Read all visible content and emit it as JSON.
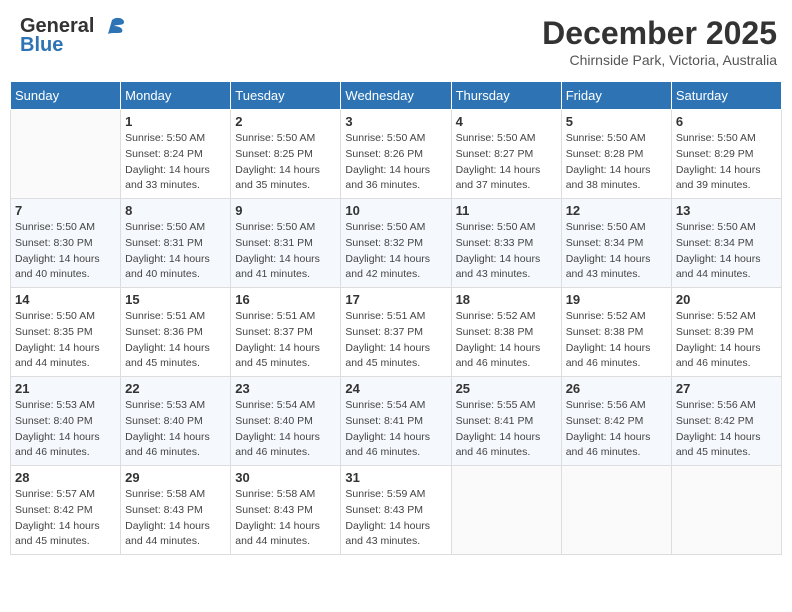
{
  "header": {
    "logo_general": "General",
    "logo_blue": "Blue",
    "month_title": "December 2025",
    "location": "Chirnside Park, Victoria, Australia"
  },
  "days_of_week": [
    "Sunday",
    "Monday",
    "Tuesday",
    "Wednesday",
    "Thursday",
    "Friday",
    "Saturday"
  ],
  "weeks": [
    [
      {
        "day": "",
        "sunrise": "",
        "sunset": "",
        "daylight": ""
      },
      {
        "day": "1",
        "sunrise": "Sunrise: 5:50 AM",
        "sunset": "Sunset: 8:24 PM",
        "daylight": "Daylight: 14 hours and 33 minutes."
      },
      {
        "day": "2",
        "sunrise": "Sunrise: 5:50 AM",
        "sunset": "Sunset: 8:25 PM",
        "daylight": "Daylight: 14 hours and 35 minutes."
      },
      {
        "day": "3",
        "sunrise": "Sunrise: 5:50 AM",
        "sunset": "Sunset: 8:26 PM",
        "daylight": "Daylight: 14 hours and 36 minutes."
      },
      {
        "day": "4",
        "sunrise": "Sunrise: 5:50 AM",
        "sunset": "Sunset: 8:27 PM",
        "daylight": "Daylight: 14 hours and 37 minutes."
      },
      {
        "day": "5",
        "sunrise": "Sunrise: 5:50 AM",
        "sunset": "Sunset: 8:28 PM",
        "daylight": "Daylight: 14 hours and 38 minutes."
      },
      {
        "day": "6",
        "sunrise": "Sunrise: 5:50 AM",
        "sunset": "Sunset: 8:29 PM",
        "daylight": "Daylight: 14 hours and 39 minutes."
      }
    ],
    [
      {
        "day": "7",
        "sunrise": "Sunrise: 5:50 AM",
        "sunset": "Sunset: 8:30 PM",
        "daylight": "Daylight: 14 hours and 40 minutes."
      },
      {
        "day": "8",
        "sunrise": "Sunrise: 5:50 AM",
        "sunset": "Sunset: 8:31 PM",
        "daylight": "Daylight: 14 hours and 40 minutes."
      },
      {
        "day": "9",
        "sunrise": "Sunrise: 5:50 AM",
        "sunset": "Sunset: 8:31 PM",
        "daylight": "Daylight: 14 hours and 41 minutes."
      },
      {
        "day": "10",
        "sunrise": "Sunrise: 5:50 AM",
        "sunset": "Sunset: 8:32 PM",
        "daylight": "Daylight: 14 hours and 42 minutes."
      },
      {
        "day": "11",
        "sunrise": "Sunrise: 5:50 AM",
        "sunset": "Sunset: 8:33 PM",
        "daylight": "Daylight: 14 hours and 43 minutes."
      },
      {
        "day": "12",
        "sunrise": "Sunrise: 5:50 AM",
        "sunset": "Sunset: 8:34 PM",
        "daylight": "Daylight: 14 hours and 43 minutes."
      },
      {
        "day": "13",
        "sunrise": "Sunrise: 5:50 AM",
        "sunset": "Sunset: 8:34 PM",
        "daylight": "Daylight: 14 hours and 44 minutes."
      }
    ],
    [
      {
        "day": "14",
        "sunrise": "Sunrise: 5:50 AM",
        "sunset": "Sunset: 8:35 PM",
        "daylight": "Daylight: 14 hours and 44 minutes."
      },
      {
        "day": "15",
        "sunrise": "Sunrise: 5:51 AM",
        "sunset": "Sunset: 8:36 PM",
        "daylight": "Daylight: 14 hours and 45 minutes."
      },
      {
        "day": "16",
        "sunrise": "Sunrise: 5:51 AM",
        "sunset": "Sunset: 8:37 PM",
        "daylight": "Daylight: 14 hours and 45 minutes."
      },
      {
        "day": "17",
        "sunrise": "Sunrise: 5:51 AM",
        "sunset": "Sunset: 8:37 PM",
        "daylight": "Daylight: 14 hours and 45 minutes."
      },
      {
        "day": "18",
        "sunrise": "Sunrise: 5:52 AM",
        "sunset": "Sunset: 8:38 PM",
        "daylight": "Daylight: 14 hours and 46 minutes."
      },
      {
        "day": "19",
        "sunrise": "Sunrise: 5:52 AM",
        "sunset": "Sunset: 8:38 PM",
        "daylight": "Daylight: 14 hours and 46 minutes."
      },
      {
        "day": "20",
        "sunrise": "Sunrise: 5:52 AM",
        "sunset": "Sunset: 8:39 PM",
        "daylight": "Daylight: 14 hours and 46 minutes."
      }
    ],
    [
      {
        "day": "21",
        "sunrise": "Sunrise: 5:53 AM",
        "sunset": "Sunset: 8:40 PM",
        "daylight": "Daylight: 14 hours and 46 minutes."
      },
      {
        "day": "22",
        "sunrise": "Sunrise: 5:53 AM",
        "sunset": "Sunset: 8:40 PM",
        "daylight": "Daylight: 14 hours and 46 minutes."
      },
      {
        "day": "23",
        "sunrise": "Sunrise: 5:54 AM",
        "sunset": "Sunset: 8:40 PM",
        "daylight": "Daylight: 14 hours and 46 minutes."
      },
      {
        "day": "24",
        "sunrise": "Sunrise: 5:54 AM",
        "sunset": "Sunset: 8:41 PM",
        "daylight": "Daylight: 14 hours and 46 minutes."
      },
      {
        "day": "25",
        "sunrise": "Sunrise: 5:55 AM",
        "sunset": "Sunset: 8:41 PM",
        "daylight": "Daylight: 14 hours and 46 minutes."
      },
      {
        "day": "26",
        "sunrise": "Sunrise: 5:56 AM",
        "sunset": "Sunset: 8:42 PM",
        "daylight": "Daylight: 14 hours and 46 minutes."
      },
      {
        "day": "27",
        "sunrise": "Sunrise: 5:56 AM",
        "sunset": "Sunset: 8:42 PM",
        "daylight": "Daylight: 14 hours and 45 minutes."
      }
    ],
    [
      {
        "day": "28",
        "sunrise": "Sunrise: 5:57 AM",
        "sunset": "Sunset: 8:42 PM",
        "daylight": "Daylight: 14 hours and 45 minutes."
      },
      {
        "day": "29",
        "sunrise": "Sunrise: 5:58 AM",
        "sunset": "Sunset: 8:43 PM",
        "daylight": "Daylight: 14 hours and 44 minutes."
      },
      {
        "day": "30",
        "sunrise": "Sunrise: 5:58 AM",
        "sunset": "Sunset: 8:43 PM",
        "daylight": "Daylight: 14 hours and 44 minutes."
      },
      {
        "day": "31",
        "sunrise": "Sunrise: 5:59 AM",
        "sunset": "Sunset: 8:43 PM",
        "daylight": "Daylight: 14 hours and 43 minutes."
      },
      {
        "day": "",
        "sunrise": "",
        "sunset": "",
        "daylight": ""
      },
      {
        "day": "",
        "sunrise": "",
        "sunset": "",
        "daylight": ""
      },
      {
        "day": "",
        "sunrise": "",
        "sunset": "",
        "daylight": ""
      }
    ]
  ]
}
